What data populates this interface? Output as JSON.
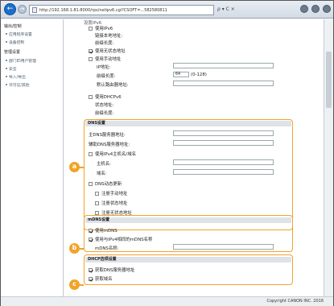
{
  "browser": {
    "url": "http://192.168.1.81:8000/rps/netipv6.cgi?CSOFT=...582580811",
    "addr_tools": "ρ ▾ C ×",
    "status_text": "Copyright CANON INC. 2016"
  },
  "sidebar": {
    "group1": "输出/控制",
    "items1": [
      "应用程序设置",
      "设备控制"
    ],
    "group2": "管理设置",
    "items2": [
      "部门ID用户管理",
      "安全",
      "导入/导出",
      "许可证/其他"
    ]
  },
  "ipv6": {
    "top_label": "设置IPv6",
    "use_ipv6": "使用IPv6",
    "link_local": "链接本地地址:",
    "prefix_length": "前缀长度:",
    "use_stateless": "使用无状态地址",
    "use_manual": "使用手动地址",
    "ip_address_label": "IP地址:",
    "prefix_label": "前缀长度:",
    "prefix_value": "64",
    "prefix_range": "(0-128)",
    "default_router": "默认路由器地址:",
    "use_dhcpv6": "使用DHCPv6",
    "stateful_address": "状态地址:",
    "stateful_prefix": "前缀长度:"
  },
  "dns": {
    "title": "DNS设置",
    "primary": "主DNS服务器地址:",
    "secondary": "辅助DNS服务器地址:",
    "same_as_ipv4": "使用IPv4主机名/域名",
    "host_name": "主机名:",
    "domain_name": "域名:",
    "dynamic_update": "DNS动态更新",
    "register_manual": "注册手动地址",
    "register_stateful": "注册状态地址",
    "register_stateless": "注册无状态地址"
  },
  "mdns": {
    "title": "mDNS设置",
    "use_mdns": "使用mDNS",
    "same_name": "使用与IPv4相同的mDNS名称",
    "mdns_name": "mDNS名称:"
  },
  "dhcp": {
    "title": "DHCP选项设置",
    "acquire_dns": "获取DNS服务器地址",
    "acquire_domain": "获取域名"
  },
  "markers": {
    "a": "a",
    "b": "b",
    "c": "c"
  },
  "colors": {
    "accent_orange": "#f0a42a",
    "nav_blue": "#1c6fc9",
    "section_header": "#dfe3e8"
  }
}
